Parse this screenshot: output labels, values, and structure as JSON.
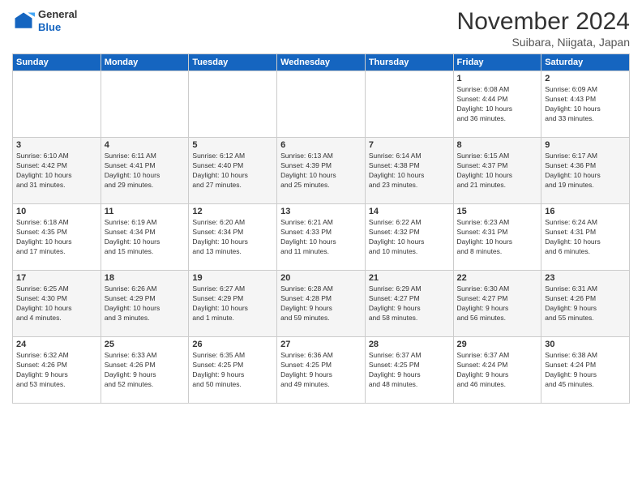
{
  "logo": {
    "general": "General",
    "blue": "Blue"
  },
  "title": "November 2024",
  "location": "Suibara, Niigata, Japan",
  "days_of_week": [
    "Sunday",
    "Monday",
    "Tuesday",
    "Wednesday",
    "Thursday",
    "Friday",
    "Saturday"
  ],
  "weeks": [
    [
      {
        "day": "",
        "info": ""
      },
      {
        "day": "",
        "info": ""
      },
      {
        "day": "",
        "info": ""
      },
      {
        "day": "",
        "info": ""
      },
      {
        "day": "",
        "info": ""
      },
      {
        "day": "1",
        "info": "Sunrise: 6:08 AM\nSunset: 4:44 PM\nDaylight: 10 hours\nand 36 minutes."
      },
      {
        "day": "2",
        "info": "Sunrise: 6:09 AM\nSunset: 4:43 PM\nDaylight: 10 hours\nand 33 minutes."
      }
    ],
    [
      {
        "day": "3",
        "info": "Sunrise: 6:10 AM\nSunset: 4:42 PM\nDaylight: 10 hours\nand 31 minutes."
      },
      {
        "day": "4",
        "info": "Sunrise: 6:11 AM\nSunset: 4:41 PM\nDaylight: 10 hours\nand 29 minutes."
      },
      {
        "day": "5",
        "info": "Sunrise: 6:12 AM\nSunset: 4:40 PM\nDaylight: 10 hours\nand 27 minutes."
      },
      {
        "day": "6",
        "info": "Sunrise: 6:13 AM\nSunset: 4:39 PM\nDaylight: 10 hours\nand 25 minutes."
      },
      {
        "day": "7",
        "info": "Sunrise: 6:14 AM\nSunset: 4:38 PM\nDaylight: 10 hours\nand 23 minutes."
      },
      {
        "day": "8",
        "info": "Sunrise: 6:15 AM\nSunset: 4:37 PM\nDaylight: 10 hours\nand 21 minutes."
      },
      {
        "day": "9",
        "info": "Sunrise: 6:17 AM\nSunset: 4:36 PM\nDaylight: 10 hours\nand 19 minutes."
      }
    ],
    [
      {
        "day": "10",
        "info": "Sunrise: 6:18 AM\nSunset: 4:35 PM\nDaylight: 10 hours\nand 17 minutes."
      },
      {
        "day": "11",
        "info": "Sunrise: 6:19 AM\nSunset: 4:34 PM\nDaylight: 10 hours\nand 15 minutes."
      },
      {
        "day": "12",
        "info": "Sunrise: 6:20 AM\nSunset: 4:34 PM\nDaylight: 10 hours\nand 13 minutes."
      },
      {
        "day": "13",
        "info": "Sunrise: 6:21 AM\nSunset: 4:33 PM\nDaylight: 10 hours\nand 11 minutes."
      },
      {
        "day": "14",
        "info": "Sunrise: 6:22 AM\nSunset: 4:32 PM\nDaylight: 10 hours\nand 10 minutes."
      },
      {
        "day": "15",
        "info": "Sunrise: 6:23 AM\nSunset: 4:31 PM\nDaylight: 10 hours\nand 8 minutes."
      },
      {
        "day": "16",
        "info": "Sunrise: 6:24 AM\nSunset: 4:31 PM\nDaylight: 10 hours\nand 6 minutes."
      }
    ],
    [
      {
        "day": "17",
        "info": "Sunrise: 6:25 AM\nSunset: 4:30 PM\nDaylight: 10 hours\nand 4 minutes."
      },
      {
        "day": "18",
        "info": "Sunrise: 6:26 AM\nSunset: 4:29 PM\nDaylight: 10 hours\nand 3 minutes."
      },
      {
        "day": "19",
        "info": "Sunrise: 6:27 AM\nSunset: 4:29 PM\nDaylight: 10 hours\nand 1 minute."
      },
      {
        "day": "20",
        "info": "Sunrise: 6:28 AM\nSunset: 4:28 PM\nDaylight: 9 hours\nand 59 minutes."
      },
      {
        "day": "21",
        "info": "Sunrise: 6:29 AM\nSunset: 4:27 PM\nDaylight: 9 hours\nand 58 minutes."
      },
      {
        "day": "22",
        "info": "Sunrise: 6:30 AM\nSunset: 4:27 PM\nDaylight: 9 hours\nand 56 minutes."
      },
      {
        "day": "23",
        "info": "Sunrise: 6:31 AM\nSunset: 4:26 PM\nDaylight: 9 hours\nand 55 minutes."
      }
    ],
    [
      {
        "day": "24",
        "info": "Sunrise: 6:32 AM\nSunset: 4:26 PM\nDaylight: 9 hours\nand 53 minutes."
      },
      {
        "day": "25",
        "info": "Sunrise: 6:33 AM\nSunset: 4:26 PM\nDaylight: 9 hours\nand 52 minutes."
      },
      {
        "day": "26",
        "info": "Sunrise: 6:35 AM\nSunset: 4:25 PM\nDaylight: 9 hours\nand 50 minutes."
      },
      {
        "day": "27",
        "info": "Sunrise: 6:36 AM\nSunset: 4:25 PM\nDaylight: 9 hours\nand 49 minutes."
      },
      {
        "day": "28",
        "info": "Sunrise: 6:37 AM\nSunset: 4:25 PM\nDaylight: 9 hours\nand 48 minutes."
      },
      {
        "day": "29",
        "info": "Sunrise: 6:37 AM\nSunset: 4:24 PM\nDaylight: 9 hours\nand 46 minutes."
      },
      {
        "day": "30",
        "info": "Sunrise: 6:38 AM\nSunset: 4:24 PM\nDaylight: 9 hours\nand 45 minutes."
      }
    ]
  ]
}
